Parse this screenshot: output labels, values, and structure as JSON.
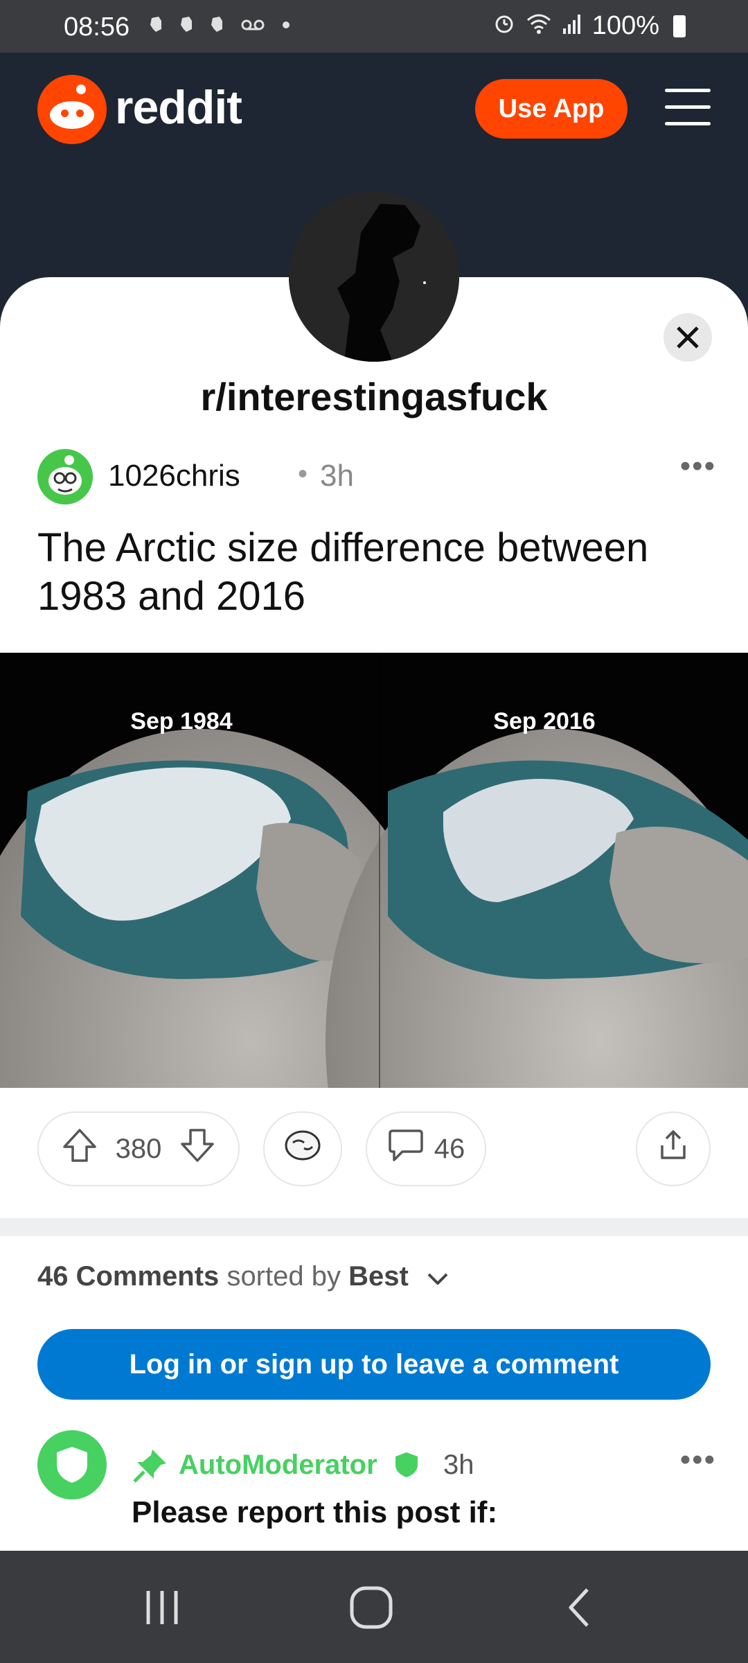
{
  "status_bar": {
    "time": "08:56",
    "notification_icons": [
      "evernote-icon",
      "evernote-icon",
      "evernote-icon",
      "voicemail-icon",
      "dot-icon"
    ],
    "battery": "100%",
    "right_icons": [
      "alarm-icon",
      "wifi-icon",
      "signal-icon"
    ]
  },
  "header": {
    "brand": "reddit",
    "use_app_label": "Use App",
    "menu_icon": "hamburger-icon",
    "colors": {
      "brand": "#ff4500",
      "bg": "#1e2533"
    }
  },
  "post": {
    "subreddit": "r/interestingasfuck",
    "author": "1026chris",
    "separator": "•",
    "age": "3h",
    "more": "•••",
    "title": "The Arctic size difference between 1983 and 2016",
    "image": {
      "left_label": "Sep 1984",
      "right_label": "Sep 2016"
    },
    "votes": "380",
    "comments_count": "46"
  },
  "comments": {
    "count_label": "46 Comments",
    "sorted_by": "sorted by",
    "sort_value": "Best",
    "login_label": "Log in or sign up to leave a comment",
    "first": {
      "author": "AutoModerator",
      "age": "3h",
      "more": "•••",
      "text": "Please report this post if:"
    }
  },
  "colors": {
    "link_blue": "#0079d3",
    "mod_green": "#46d160"
  }
}
